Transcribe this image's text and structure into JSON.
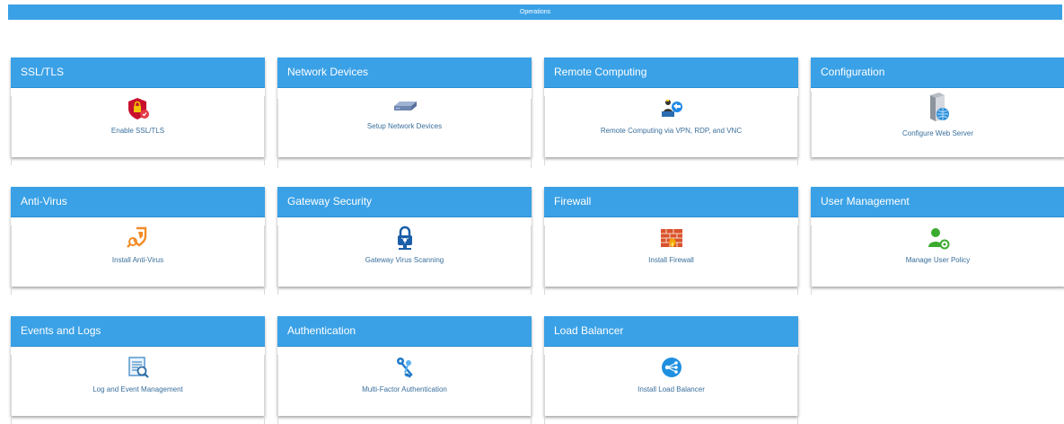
{
  "header": {
    "title": "Operations"
  },
  "cards": [
    {
      "title": "SSL/TLS",
      "action": "Enable SSL/TLS",
      "icon": "shield-lock-icon"
    },
    {
      "title": "Network Devices",
      "action": "Setup Network Devices",
      "icon": "network-device-icon"
    },
    {
      "title": "Remote Computing",
      "action": "Remote Computing via VPN, RDP, and VNC",
      "icon": "remote-computing-icon"
    },
    {
      "title": "Configuration",
      "action": "Configure Web Server",
      "icon": "web-server-icon"
    },
    {
      "title": "Anti-Virus",
      "action": "Install Anti-Virus",
      "icon": "antivirus-shield-icon"
    },
    {
      "title": "Gateway Security",
      "action": "Gateway Virus Scanning",
      "icon": "gateway-lock-icon"
    },
    {
      "title": "Firewall",
      "action": "Install Firewall",
      "icon": "firewall-icon"
    },
    {
      "title": "User Management",
      "action": "Manage User Policy",
      "icon": "user-settings-icon"
    },
    {
      "title": "Events and Logs",
      "action": "Log and Event Management",
      "icon": "log-search-icon"
    },
    {
      "title": "Authentication",
      "action": "Multi-Factor Authentication",
      "icon": "keys-icon"
    },
    {
      "title": "Load Balancer",
      "action": "Install Load Balancer",
      "icon": "load-balancer-icon"
    }
  ],
  "colors": {
    "header_blue": "#3aa1e6",
    "label_blue": "#3a6f9c"
  }
}
